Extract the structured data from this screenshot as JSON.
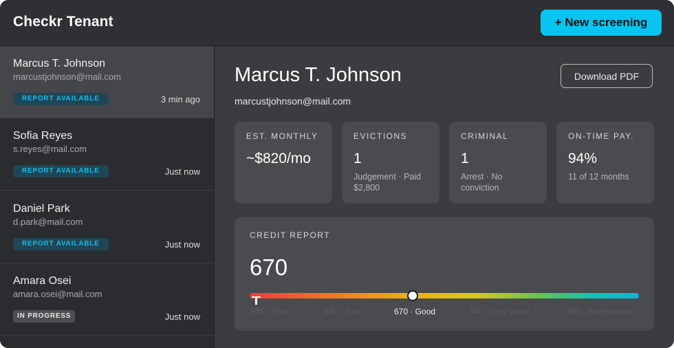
{
  "app": {
    "title": "Checkr Tenant"
  },
  "header": {
    "new_button": "+ New screening"
  },
  "candidates": [
    {
      "name": "Marcus T. Johnson",
      "email": "marcustjohnson@mail.com",
      "status": "REPORT AVAILABLE",
      "time": "3 min ago",
      "selected": true
    },
    {
      "name": "Sofia Reyes",
      "email": "s.reyes@mail.com",
      "status": "REPORT AVAILABLE",
      "time": "Just now"
    },
    {
      "name": "Daniel Park",
      "email": "d.park@mail.com",
      "status": "REPORT AVAILABLE",
      "time": "Just now"
    },
    {
      "name": "Amara Osei",
      "email": "amara.osei@mail.com",
      "status": "IN PROGRESS",
      "time": "Just now"
    }
  ],
  "detail": {
    "name": "Marcus T. Johnson",
    "email": "marcustjohnson@mail.com",
    "download_button": "Download PDF",
    "stats": [
      {
        "label": "EST. MONTHLY",
        "value": "~$820/mo",
        "sub": ""
      },
      {
        "label": "EVICTIONS",
        "value": "1",
        "sub": "Judgement · Paid $2,800"
      },
      {
        "label": "CRIMINAL",
        "value": "1",
        "sub": "Arrest · No conviction"
      },
      {
        "label": "ON-TIME PAY.",
        "value": "94%",
        "sub": "11 of 12 months"
      }
    ],
    "credit": {
      "label": "CREDIT REPORT",
      "score": "670",
      "score_value": 670,
      "scale_min": 300,
      "scale_max": 850,
      "tick_labels": [
        "300 · Poor",
        "580 · Fair",
        "670 · Good",
        "740 · Very Good",
        "850 · Exceptional"
      ]
    }
  },
  "colors": {
    "accent": "#08c4f0",
    "badge_available_text": "#19b9e6",
    "window_bg": "#2b2c2f",
    "panel_bg": "#3b3c3f",
    "card_bg": "#4a4b4e"
  }
}
